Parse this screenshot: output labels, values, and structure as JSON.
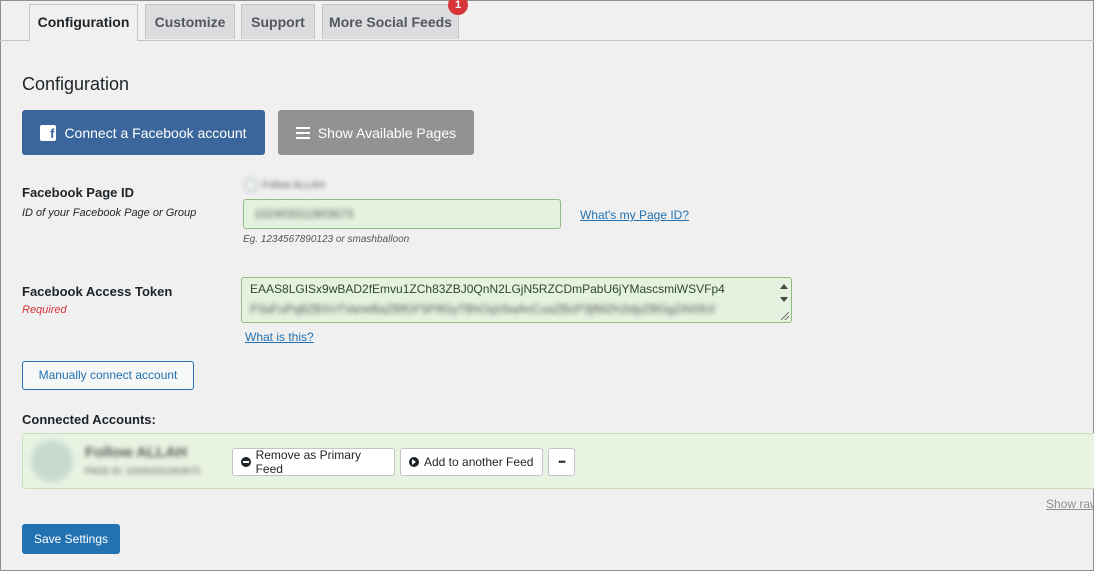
{
  "tabs": [
    {
      "label": "Configuration"
    },
    {
      "label": "Customize"
    },
    {
      "label": "Support"
    },
    {
      "label": "More Social Feeds",
      "badge": "1"
    }
  ],
  "section_title": "Configuration",
  "buttons": {
    "connect_facebook": "Connect a Facebook account",
    "show_pages": "Show Available Pages",
    "manual_connect": "Manually connect account",
    "save": "Save Settings"
  },
  "page_id": {
    "label": "Facebook Page ID",
    "description": "ID of your Facebook Page or Group",
    "page_hint": "Follow ALLAH",
    "value": "102403311903673",
    "help_link": "What's my Page ID?",
    "example": "Eg. 1234567890123 or smashballoon"
  },
  "access_token": {
    "label": "Facebook Access Token",
    "required": "Required",
    "value_line1": "EAAS8LGISx9wBAD2fEmvu1ZCh83ZBJ0QnN2LGjN5RZCDmPabU6jYMascsmiWSVFp4",
    "value_line2": "P3aFuPq8ZBXnTVaneBaZBfGF5P9GyTBhOqVbaAnCuaZBzP3jfMZh2ldpZBGgZAI09J/",
    "help_link": "What is this?"
  },
  "connected": {
    "heading": "Connected Accounts:",
    "account_name": "Follow ALLAH",
    "account_id": "PAGE ID: 102403311903673",
    "remove_primary": "Remove as Primary Feed",
    "add_feed": "Add to another Feed",
    "more": "•••",
    "show_raw": "Show raw"
  },
  "colors": {
    "primary": "#2271b1",
    "facebook": "#3a669b",
    "required": "#d63638",
    "success_bg": "#e9f3e2"
  }
}
